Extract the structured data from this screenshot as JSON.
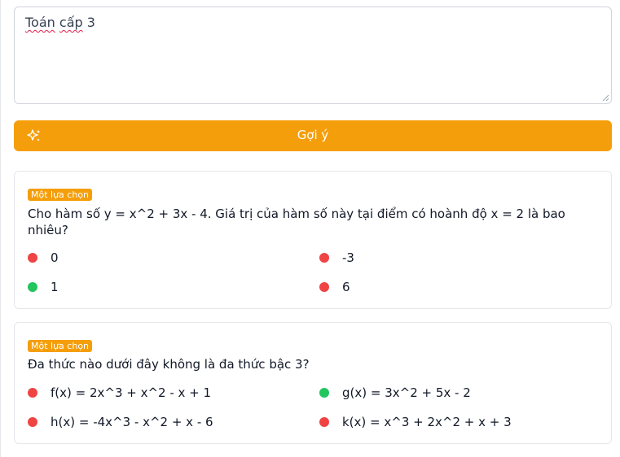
{
  "prompt": {
    "value_word_1": "Toán",
    "value_word_2": "cấp",
    "value_word_3": "3"
  },
  "suggest_button": {
    "label": "Gợi ý",
    "icon": "sparkle-icon"
  },
  "questions": [
    {
      "type_label": "Một lựa chọn",
      "text": "Cho hàm số y = x^2 + 3x - 4. Giá trị của hàm số này tại điểm có hoành độ x = 2 là bao nhiêu?",
      "options": [
        {
          "label": "0",
          "correct": false
        },
        {
          "label": "-3",
          "correct": false
        },
        {
          "label": "1",
          "correct": true
        },
        {
          "label": "6",
          "correct": false
        }
      ]
    },
    {
      "type_label": "Một lựa chọn",
      "text": "Đa thức nào dưới đây không là đa thức bậc 3?",
      "options": [
        {
          "label": "f(x) = 2x^3 + x^2 - x + 1",
          "correct": false
        },
        {
          "label": "g(x) = 3x^2 + 5x - 2",
          "correct": true
        },
        {
          "label": "h(x) = -4x^3 - x^2 + x - 6",
          "correct": false
        },
        {
          "label": "k(x) = x^3 + 2x^2 + x + 3",
          "correct": false
        }
      ]
    }
  ],
  "colors": {
    "accent": "#f59e0b",
    "correct": "#22c55e",
    "incorrect": "#ef4444"
  }
}
